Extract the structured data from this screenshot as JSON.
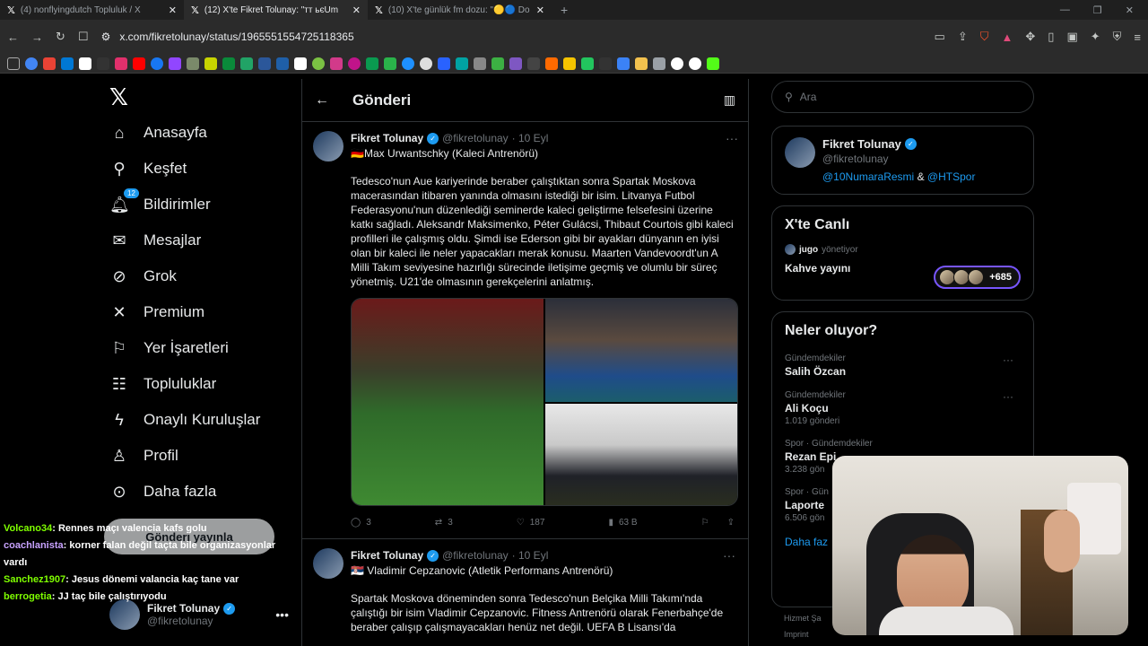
{
  "browser": {
    "tabs": [
      {
        "label": "(4) nonflyingdutch Topluluk / X",
        "active": false
      },
      {
        "label": "(12) X'te Fikret Tolunay: \"тт ьєUm",
        "active": true
      },
      {
        "label": "(10) X'te günlük fm dozu: \"🟡🔵 Do",
        "active": false
      }
    ],
    "url": "x.com/fikretolunay/status/1965551554725118365"
  },
  "nav": {
    "items": [
      {
        "label": "Anasayfa",
        "icon": "home-icon"
      },
      {
        "label": "Keşfet",
        "icon": "search-icon"
      },
      {
        "label": "Bildirimler",
        "icon": "bell-icon",
        "badge": "12"
      },
      {
        "label": "Mesajlar",
        "icon": "mail-icon"
      },
      {
        "label": "Grok",
        "icon": "grok-icon"
      },
      {
        "label": "Premium",
        "icon": "x-icon"
      },
      {
        "label": "Yer İşaretleri",
        "icon": "bookmark-icon"
      },
      {
        "label": "Topluluklar",
        "icon": "communities-icon"
      },
      {
        "label": "Onaylı Kuruluşlar",
        "icon": "lightning-icon"
      },
      {
        "label": "Profil",
        "icon": "person-icon"
      },
      {
        "label": "Daha fazla",
        "icon": "more-circle-icon"
      }
    ],
    "post_button": "Gönderi yayınla",
    "account_name": "Fikret Tolunay",
    "account_handle": "@fikretolunay"
  },
  "chat": [
    {
      "user": "Volcano34",
      "msg": ": Rennes maçı valencia kafs golu",
      "color": "#7fff00"
    },
    {
      "user": "coachlanista",
      "msg": ": korner falan değil taçta bile organizasyonlar vardı",
      "color": "#c8a2ff"
    },
    {
      "user": "Sanchez1907",
      "msg": ": Jesus dönemi valancia kaç tane var",
      "color": "#7fff00"
    },
    {
      "user": "berrogetia",
      "msg": ": JJ taç bile çalıştırıyodu",
      "color": "#7fff00"
    }
  ],
  "center": {
    "title": "Gönderi",
    "tweets": [
      {
        "name": "Fikret Tolunay",
        "handle": "@fikretolunay",
        "date": "· 10 Eyl",
        "subtitle": "🇩🇪Max Urwantschky (Kaleci Antrenörü)",
        "text": "Tedesco'nun Aue kariyerinde beraber çalıştıktan sonra Spartak Moskova macerasından itibaren yanında olmasını istediği bir isim. Litvanya Futbol Federasyonu'nun düzenlediği seminerde kaleci geliştirme felsefesini üzerine katkı sağladı. Aleksandr Maksimenko, Péter Gulácsi, Thibaut Courtois gibi kaleci profilleri ile çalışmış oldu. Şimdi ise Ederson gibi bir ayakları dünyanın en iyisi olan bir kaleci ile neler yapacakları merak konusu. Maarten Vandevoordt'un A Milli Takım seviyesine hazırlığı sürecinde iletişime geçmiş ve olumlu bir süreç yönetmiş. U21'de olmasının gerekçelerini anlatmış.",
        "replies": "3",
        "reposts": "3",
        "likes": "187",
        "views": "63 B"
      },
      {
        "name": "Fikret Tolunay",
        "handle": "@fikretolunay",
        "date": "· 10 Eyl",
        "subtitle": "🇷🇸 Vladimir Cepzanovic (Atletik Performans Antrenörü)",
        "text": "Spartak Moskova döneminden sonra Tedesco'nun Belçika Milli Takımı'nda çalıştığı bir isim Vladimir Cepzanovic. Fitness Antrenörü olarak Fenerbahçe'de beraber çalışıp çalışmayacakları henüz net değil. UEFA B Lisansı'da"
      }
    ]
  },
  "right": {
    "search_placeholder": "Ara",
    "profile": {
      "name": "Fikret Tolunay",
      "handle": "@fikretolunay",
      "link1": "@10NumaraResmi",
      "amp": "&",
      "link2": "@HTSpor"
    },
    "live": {
      "title": "X'te Canlı",
      "host": "jugo",
      "host_role": "yönetiyor",
      "space": "Kahve yayını",
      "listeners": "+685"
    },
    "trends": {
      "title": "Neler oluyor?",
      "items": [
        {
          "category": "Gündemdekiler",
          "name": "Salih Özcan",
          "count": ""
        },
        {
          "category": "Gündemdekiler",
          "name": "Ali Koçu",
          "count": "1.019 gönderi"
        },
        {
          "category": "Spor · Gündemdekiler",
          "name": "Rezan Epi",
          "count": "3.238 gön"
        },
        {
          "category": "Spor · Gün",
          "name": "Laporte",
          "count": "6.506 gön"
        }
      ],
      "more": "Daha faz"
    },
    "footer": [
      "Hizmet Şa",
      "Imprint"
    ]
  },
  "colors": {
    "accent": "#1d9bf0",
    "background": "#000000",
    "border": "#2f3336",
    "muted": "#71767b"
  }
}
